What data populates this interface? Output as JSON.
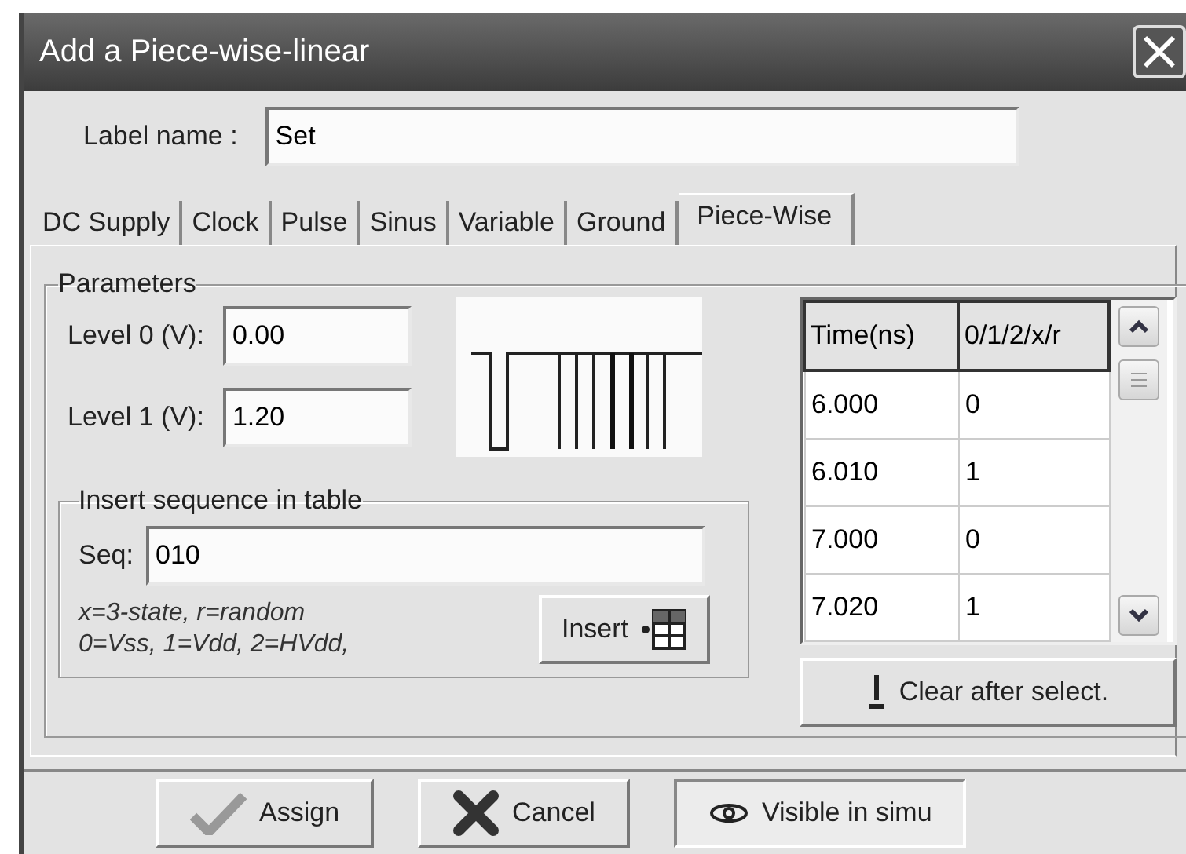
{
  "window": {
    "title": "Add a Piece-wise-linear"
  },
  "label_name": {
    "label": "Label name :",
    "value": "Set"
  },
  "tabs": [
    {
      "label": "DC Supply",
      "selected": false
    },
    {
      "label": "Clock",
      "selected": false
    },
    {
      "label": "Pulse",
      "selected": false
    },
    {
      "label": "Sinus",
      "selected": false
    },
    {
      "label": "Variable",
      "selected": false
    },
    {
      "label": "Ground",
      "selected": false
    },
    {
      "label": "Piece-Wise",
      "selected": true
    }
  ],
  "parameters": {
    "title": "Parameters",
    "level_0": {
      "label": "Level 0 (V):",
      "value": "0.00"
    },
    "level_1": {
      "label": "Level 1 (V):",
      "value": "1.20"
    }
  },
  "insert_sequence": {
    "title": "Insert sequence in table",
    "seq_label": "Seq:",
    "seq_value": "010",
    "hint_1": "x=3-state, r=random",
    "hint_2": "0=Vss, 1=Vdd, 2=HVdd,",
    "button": "Insert"
  },
  "table": {
    "columns": [
      "Time(ns)",
      "0/1/2/x/r"
    ],
    "rows": [
      [
        "6.000",
        "0"
      ],
      [
        "6.010",
        "1"
      ],
      [
        "7.000",
        "0"
      ],
      [
        "7.020",
        "1"
      ]
    ]
  },
  "clear_button": "Clear after select.",
  "buttons": [
    {
      "kind": "assign",
      "label": "Assign",
      "pressed": false
    },
    {
      "kind": "cancel",
      "label": "Cancel",
      "pressed": false
    },
    {
      "kind": "visible",
      "label": "Visible in simu",
      "pressed": true
    }
  ]
}
